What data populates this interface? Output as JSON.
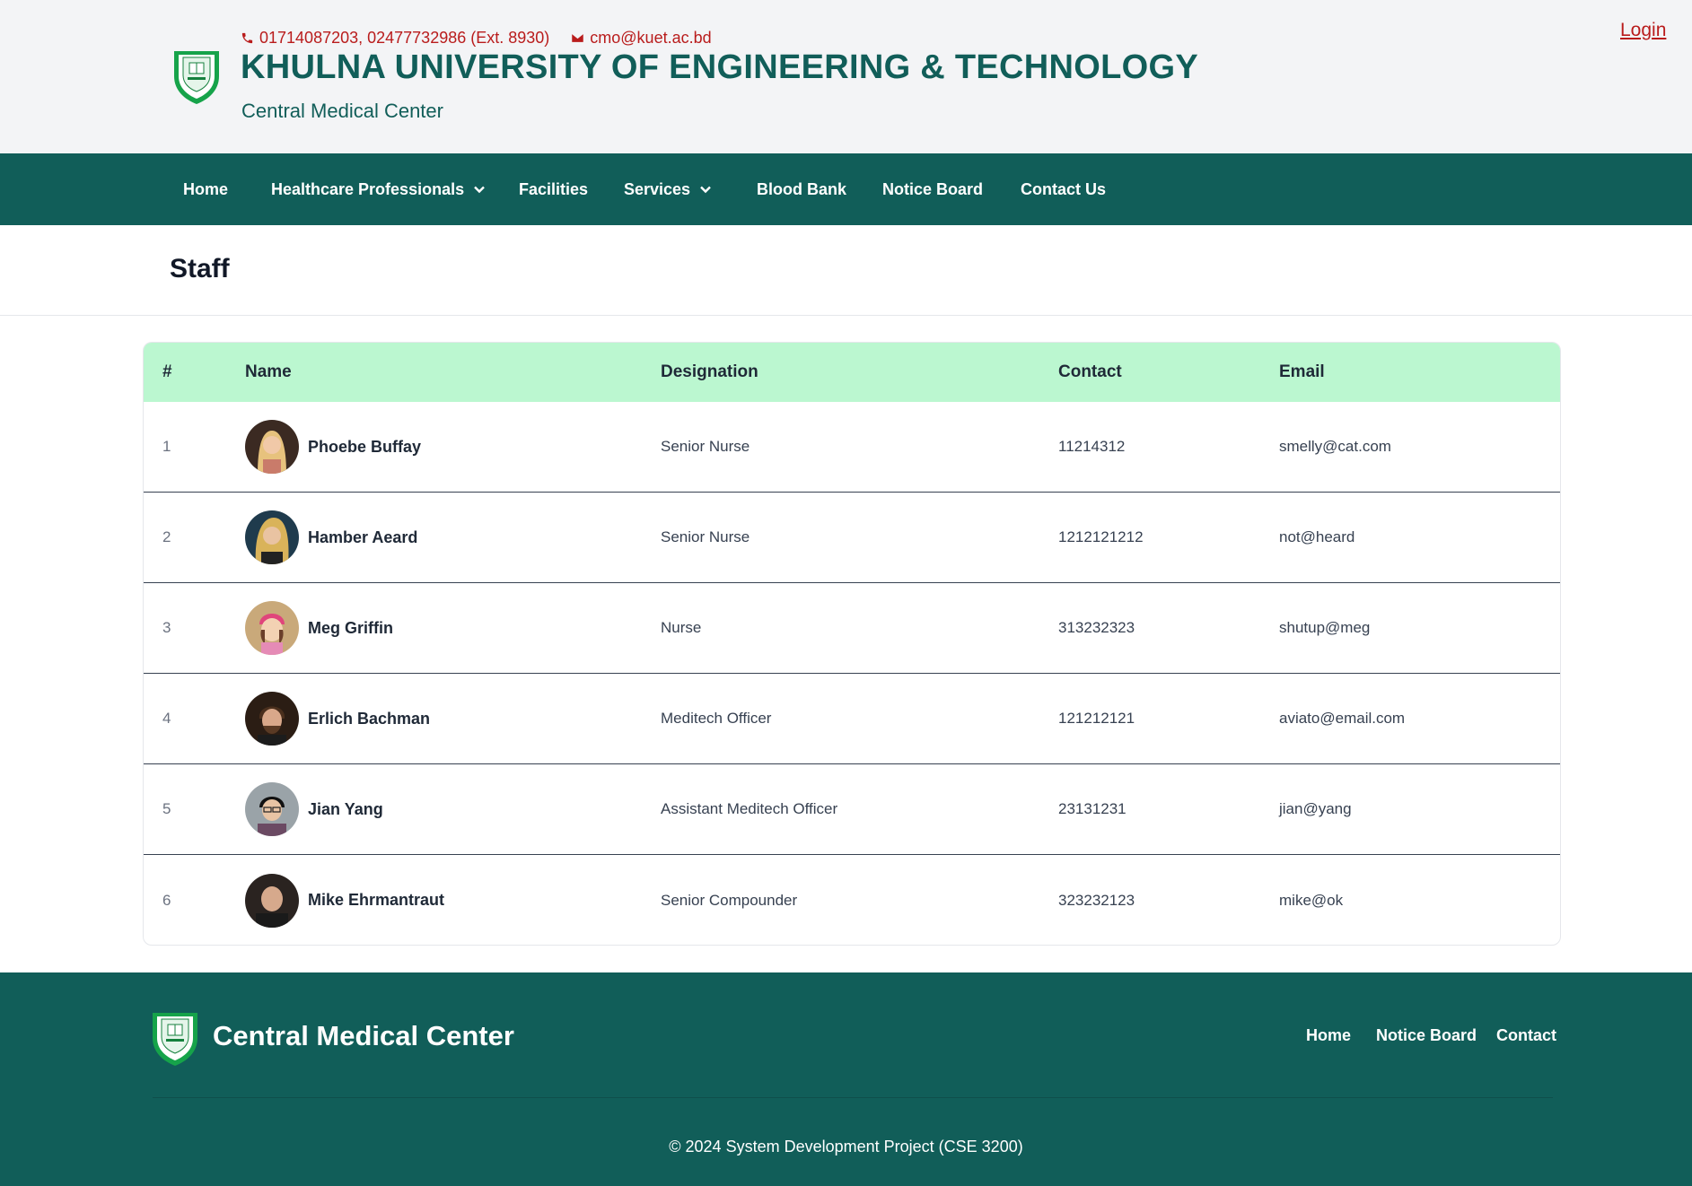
{
  "header": {
    "phone": "01714087203, 02477732986 (Ext. 8930)",
    "email": "cmo@kuet.ac.bd",
    "title": "KHULNA UNIVERSITY OF ENGINEERING & TECHNOLOGY",
    "subtitle": "Central Medical Center",
    "login_label": "Login"
  },
  "nav": {
    "items": [
      {
        "label": "Home"
      },
      {
        "label": "Healthcare Professionals"
      },
      {
        "label": "Facilities"
      },
      {
        "label": "Services"
      },
      {
        "label": "Blood Bank"
      },
      {
        "label": "Notice Board"
      },
      {
        "label": "Contact Us"
      }
    ]
  },
  "page": {
    "title": "Staff"
  },
  "table": {
    "columns": [
      "#",
      "Name",
      "Designation",
      "Contact",
      "Email"
    ],
    "rows": [
      {
        "num": "1",
        "name": "Phoebe Buffay",
        "designation": "Senior Nurse",
        "contact": "11214312",
        "email": "smelly@cat.com"
      },
      {
        "num": "2",
        "name": "Hamber Aeard",
        "designation": "Senior Nurse",
        "contact": "1212121212",
        "email": "not@heard"
      },
      {
        "num": "3",
        "name": "Meg Griffin",
        "designation": "Nurse",
        "contact": "313232323",
        "email": "shutup@meg"
      },
      {
        "num": "4",
        "name": "Erlich Bachman",
        "designation": "Meditech Officer",
        "contact": "121212121",
        "email": "aviato@email.com"
      },
      {
        "num": "5",
        "name": "Jian Yang",
        "designation": "Assistant Meditech Officer",
        "contact": "23131231",
        "email": "jian@yang"
      },
      {
        "num": "6",
        "name": "Mike Ehrmantraut",
        "designation": "Senior Compounder",
        "contact": "323232123",
        "email": "mike@ok"
      }
    ]
  },
  "footer": {
    "brand": "Central Medical Center",
    "links": [
      {
        "label": "Home"
      },
      {
        "label": "Notice Board"
      },
      {
        "label": "Contact"
      }
    ],
    "copyright": "© 2024 System Development Project (CSE 3200)"
  },
  "colors": {
    "primary": "#115e59",
    "accent_red": "#b91c1c",
    "table_header": "#bbf7d0",
    "header_bg": "#f3f4f6"
  },
  "icons": {
    "phone": "phone-icon",
    "email": "envelope-icon",
    "dropdown": "chevron-down-icon",
    "logo": "kuet-shield-logo"
  }
}
